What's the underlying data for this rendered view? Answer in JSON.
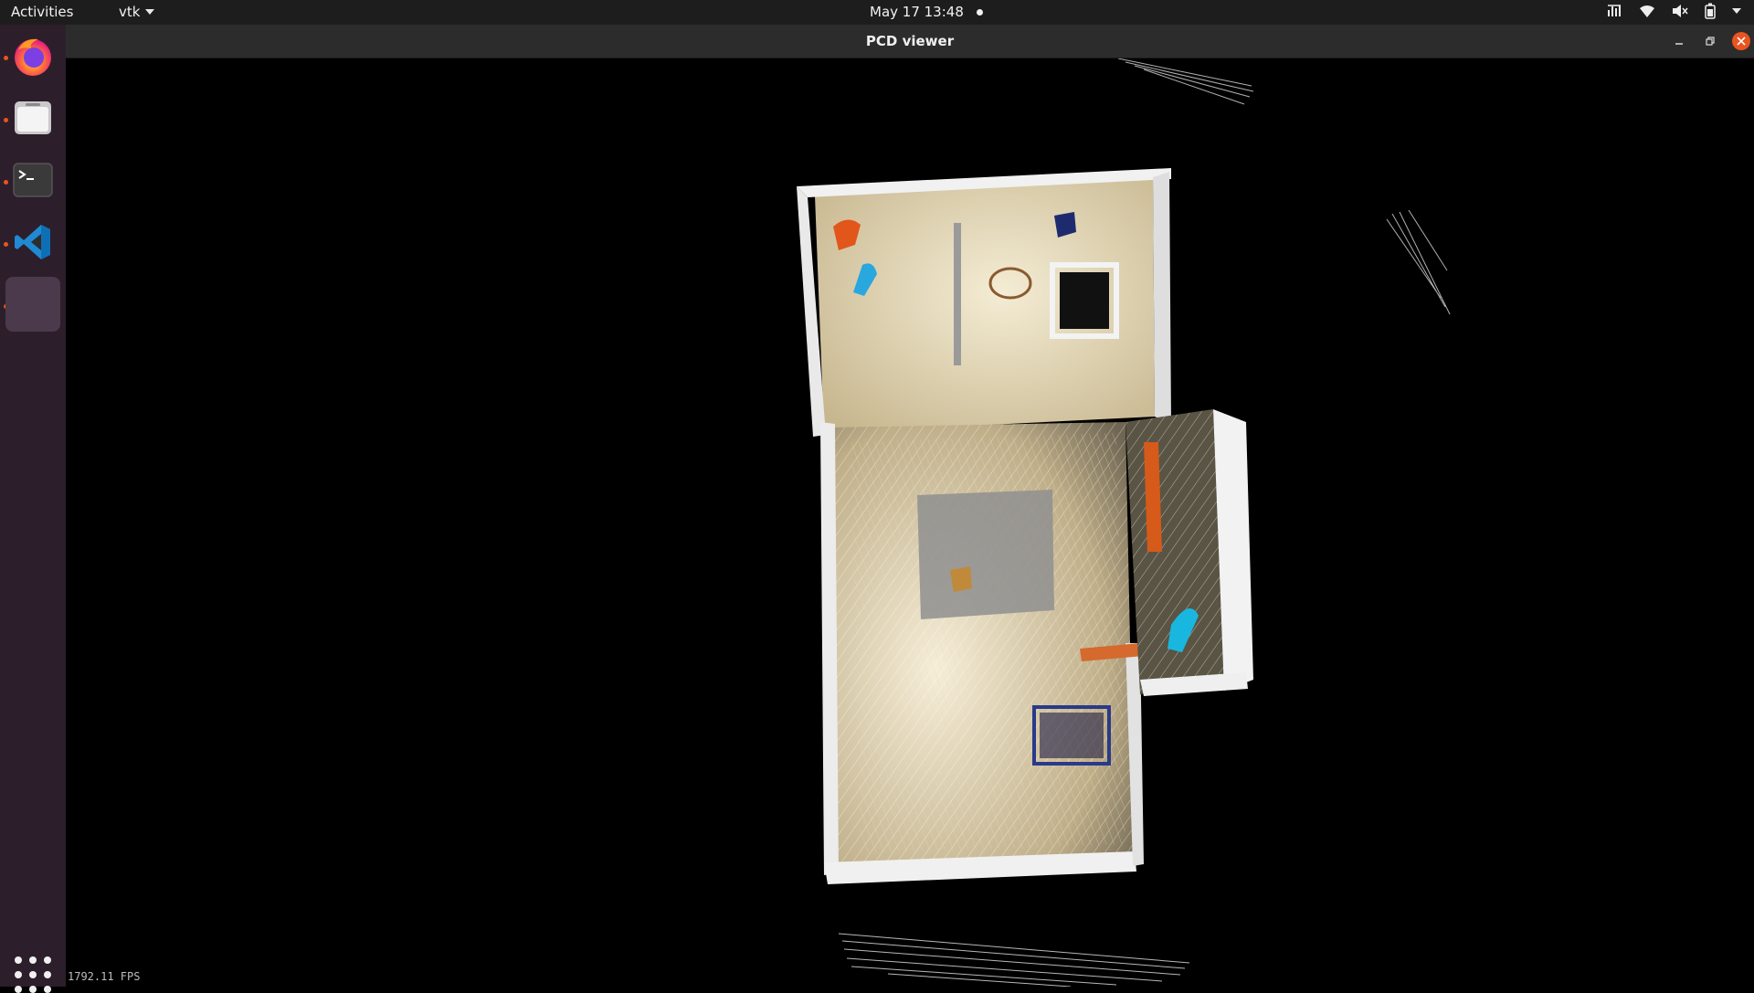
{
  "topbar": {
    "activities": "Activities",
    "app_menu": "vtk",
    "datetime": "May 17  13:48"
  },
  "dock": {
    "items": [
      {
        "name": "Firefox",
        "icon": "firefox-icon",
        "running": true
      },
      {
        "name": "Files",
        "icon": "files-icon",
        "running": true
      },
      {
        "name": "Terminal",
        "icon": "terminal-icon",
        "running": true
      },
      {
        "name": "Visual Studio Code",
        "icon": "vscode-icon",
        "running": true
      },
      {
        "name": "PCD viewer",
        "icon": "vtk-window-icon",
        "running": true,
        "active": true
      }
    ]
  },
  "window": {
    "title": "PCD viewer"
  },
  "viewer": {
    "fps_text": "1792.11 FPS"
  },
  "colors": {
    "topbar": "#1d1d1d",
    "dock": "#2d1e2b",
    "accent": "#e95420",
    "floor": "#d9cba6",
    "walls": "#f2f2f2"
  }
}
